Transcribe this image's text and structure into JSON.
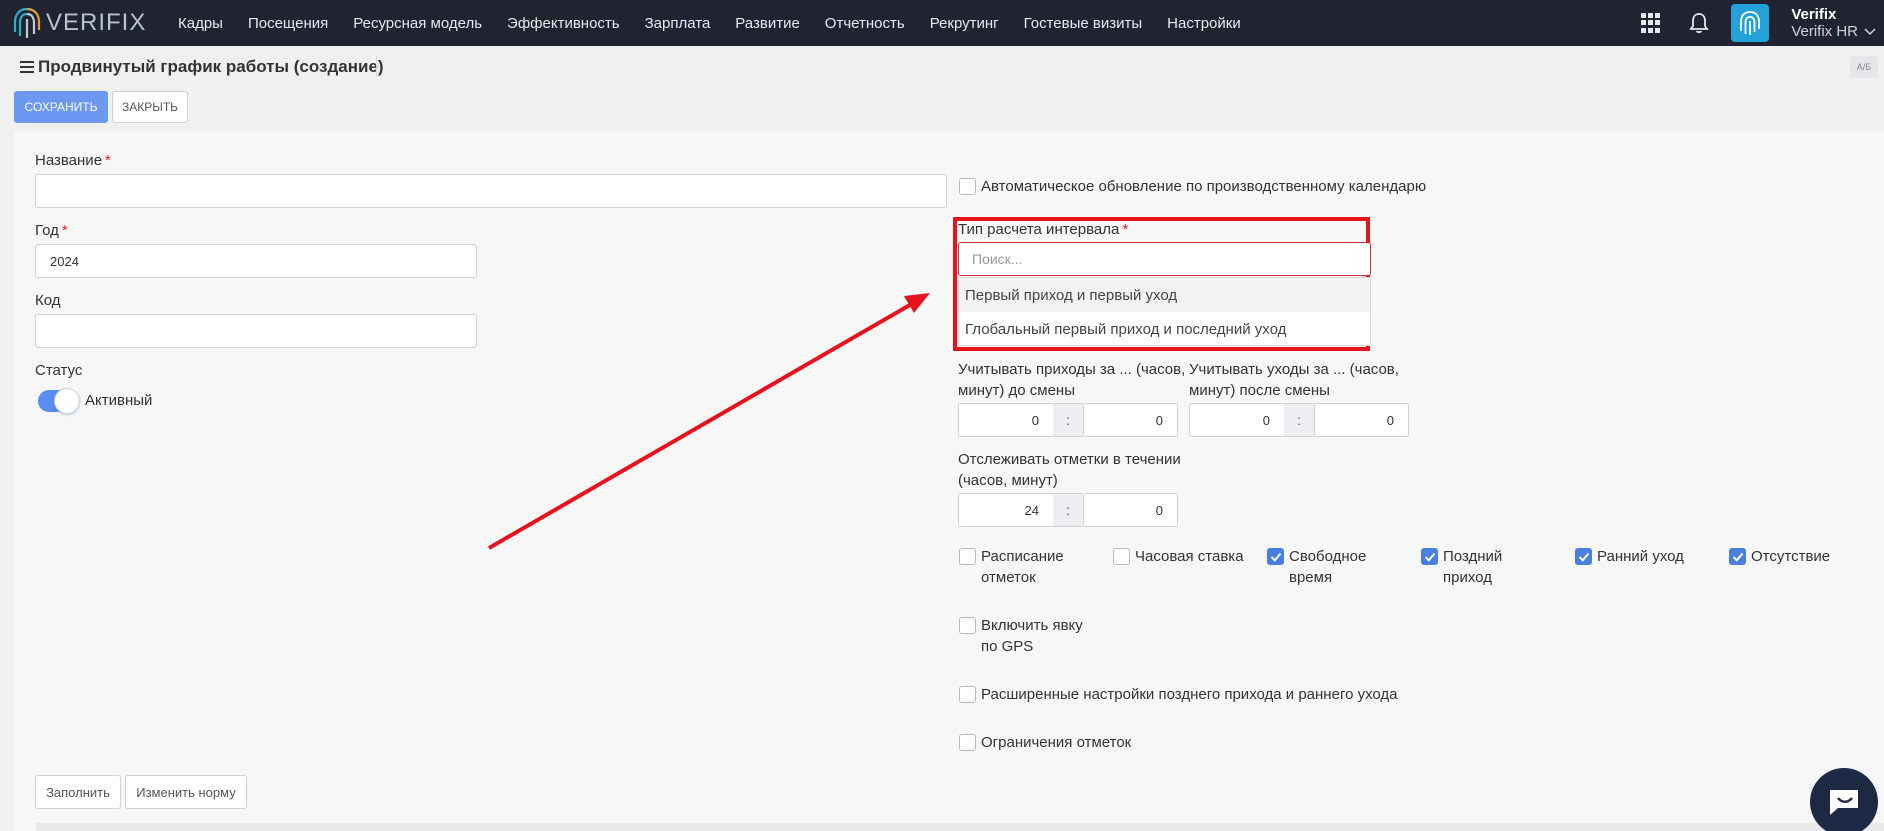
{
  "app": {
    "logo_text": "VERIFIX",
    "nav": [
      "Кадры",
      "Посещения",
      "Ресурсная модель",
      "Эффективность",
      "Зарплата",
      "Развитие",
      "Отчетность",
      "Рекрутинг",
      "Гостевые визиты",
      "Настройки"
    ],
    "user_name": "Verifix",
    "user_company": "Verifix HR"
  },
  "page": {
    "title": "Продвинутый график работы (создание)",
    "save_label": "СОХРАНИТЬ",
    "close_label": "ЗАКРЫТЬ",
    "lang_icon_text": "A/Б"
  },
  "form": {
    "name_label": "Название",
    "name_value": "",
    "year_label": "Год",
    "year_value": "2024",
    "code_label": "Код",
    "code_value": "",
    "status_label": "Статус",
    "status_value": "Активный",
    "status_on": true,
    "auto_update_label": "Автоматическое обновление по производственному календарю",
    "interval_label": "Тип расчета интервала",
    "interval_search_placeholder": "Поиск...",
    "interval_options": [
      "Первый приход и первый уход",
      "Глобальный первый приход и последний уход"
    ],
    "arrivals_label_1": "Учитывать приходы за ... (часов,",
    "arrivals_label_2": "минут) до смены",
    "arrivals_hours": "0",
    "arrivals_minutes": "0",
    "departures_label_1": "Учитывать уходы за ... (часов,",
    "departures_label_2": "минут) после смены",
    "departures_hours": "0",
    "departures_minutes": "0",
    "track_label_1": "Отслеживать отметки в течении",
    "track_label_2": "(часов, минут)",
    "track_hours": "24",
    "track_minutes": "0",
    "time_separator": ":",
    "checkboxes": {
      "schedule_marks_1": "Расписание",
      "schedule_marks_2": "отметок",
      "hourly_rate": "Часовая ставка",
      "free_time_1": "Свободное",
      "free_time_2": "время",
      "late_arrival_1": "Поздний",
      "late_arrival_2": "приход",
      "early_leave": "Ранний уход",
      "absence": "Отсутствие",
      "gps_1": "Включить явку",
      "gps_2": "по GPS",
      "advanced_late": "Расширенные настройки позднего прихода и раннего ухода",
      "mark_limits": "Ограничения отметок"
    },
    "fill_label": "Заполнить",
    "change_norm_label": "Изменить норму"
  },
  "colors": {
    "navbar": "#1f2430",
    "primary": "#6c98f1",
    "highlight": "#e8121c",
    "checkbox_checked": "#4a7fe0"
  }
}
